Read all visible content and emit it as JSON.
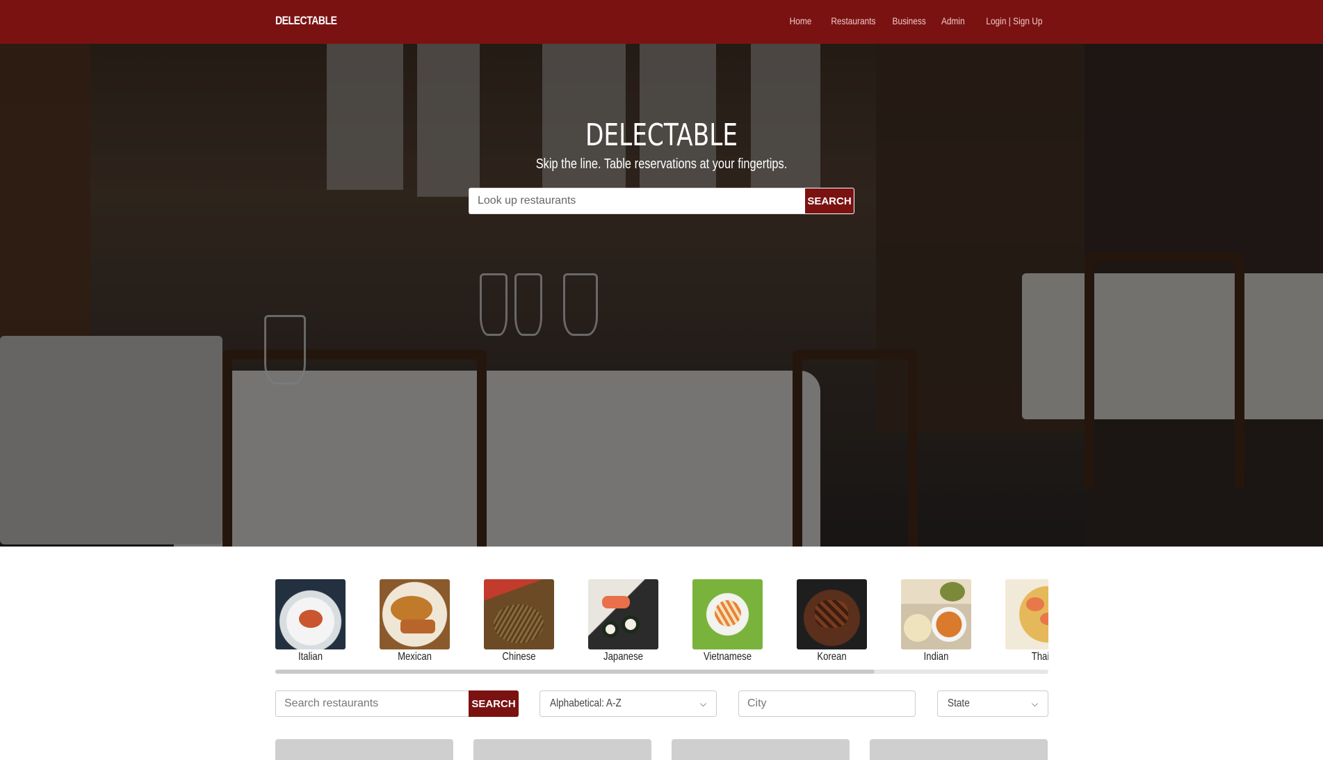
{
  "nav": {
    "brand": "DELECTABLE",
    "links": [
      "Home",
      "Restaurants",
      "Business",
      "Admin",
      "Login | Sign Up"
    ]
  },
  "hero": {
    "title": "DELECTABLE",
    "subtitle": "Skip the line. Table reservations at your fingertips.",
    "search_placeholder": "Look up restaurants",
    "search_button": "SEARCH"
  },
  "categories": [
    {
      "label": "Italian",
      "color": "#c9562e"
    },
    {
      "label": "Mexican",
      "color": "#c07a2a"
    },
    {
      "label": "Chinese",
      "color": "#6b4a25"
    },
    {
      "label": "Japanese",
      "color": "#d9683a"
    },
    {
      "label": "Vietnamese",
      "color": "#7ab33b"
    },
    {
      "label": "Korean",
      "color": "#5a2f1c"
    },
    {
      "label": "Indian",
      "color": "#d48a32"
    },
    {
      "label": "Thai",
      "color": "#d9a441"
    }
  ],
  "filters": {
    "search_placeholder": "Search restaurants",
    "search_button": "SEARCH",
    "sort_value": "Alphabetical: A-Z",
    "city_placeholder": "City",
    "state_value": "State"
  },
  "colors": {
    "brand": "#7b1212"
  }
}
